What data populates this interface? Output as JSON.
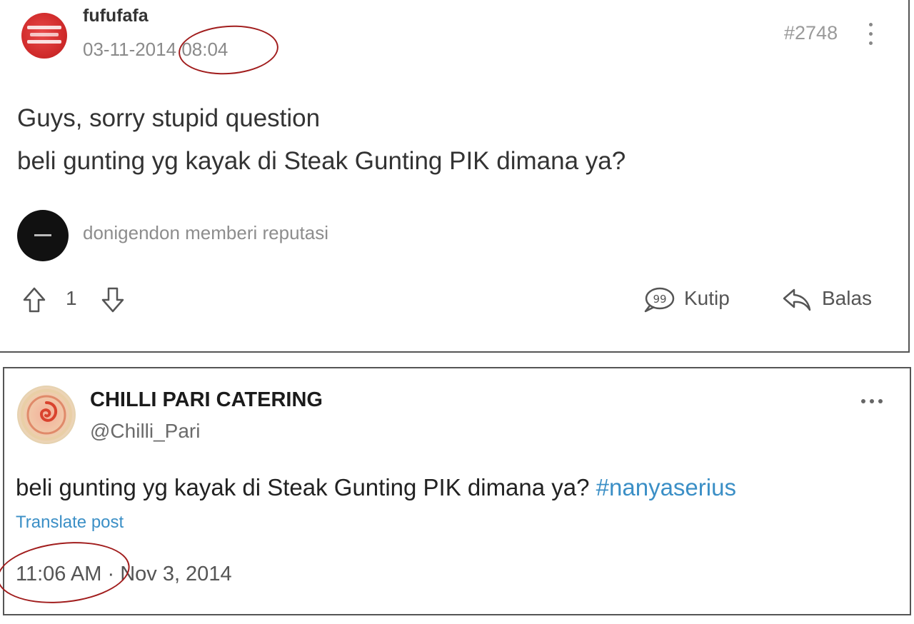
{
  "colors": {
    "link_blue": "#3b8fc6",
    "annotation_red": "#a11d1d",
    "muted_gray": "#8a8a8a"
  },
  "forum_post": {
    "avatar_icon": "red-logo-avatar",
    "username": "fufufafa",
    "timestamp_date": "03-11-2014",
    "timestamp_time": "08:04",
    "post_number": "#2748",
    "menu_icon": "vertical-ellipsis-icon",
    "body_lines": [
      "Guys, sorry stupid question",
      "beli gunting yg kayak di Steak Gunting PIK dimana ya?"
    ],
    "reputation": {
      "avatar_icon": "black-circle-avatar",
      "text": "donigendon memberi reputasi"
    },
    "actions": {
      "upvote_icon": "arrow-up-icon",
      "vote_count": "1",
      "downvote_icon": "arrow-down-icon",
      "quote_icon": "quote-bubble-icon",
      "quote_label": "Kutip",
      "reply_icon": "reply-arrow-icon",
      "reply_label": "Balas"
    }
  },
  "tweet": {
    "avatar_icon": "chilli-spiral-avatar",
    "display_name": "CHILLI PARI CATERING",
    "handle": "@Chilli_Pari",
    "menu_icon": "horizontal-ellipsis-icon",
    "text": "beli gunting yg kayak di Steak Gunting PIK dimana ya?",
    "hashtag": "#nanyaserius",
    "translate_label": "Translate post",
    "time": "11:06 AM",
    "separator": "·",
    "date": "Nov 3, 2014"
  }
}
